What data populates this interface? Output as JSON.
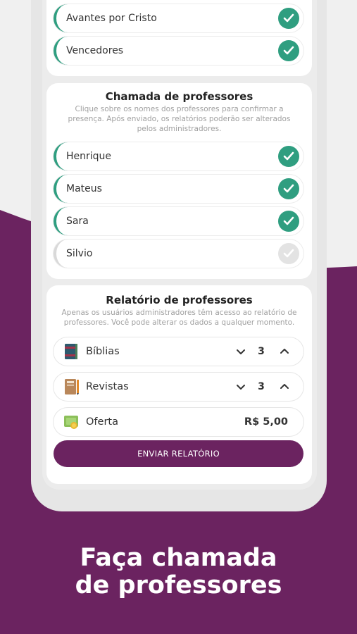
{
  "colors": {
    "accent": "#2f9e80",
    "brand": "#6b2360",
    "inactive": "#e3e3e3"
  },
  "classes": [
    {
      "name": "Avantes por Cristo",
      "checked": true
    },
    {
      "name": "Vencedores",
      "checked": true
    }
  ],
  "teachers_call": {
    "title": "Chamada de professores",
    "description": "Clique sobre os nomes dos professores para confirmar a presença. Após enviado, os relatórios poderão ser alterados pelos administradores.",
    "teachers": [
      {
        "name": "Henrique",
        "checked": true
      },
      {
        "name": "Mateus",
        "checked": true
      },
      {
        "name": "Sara",
        "checked": true
      },
      {
        "name": "Silvio",
        "checked": false
      }
    ]
  },
  "report": {
    "title": "Relatório de professores",
    "description": "Apenas os usuários administradores têm acesso ao relatório de professores. Você pode alterar os dados a qualquer momento.",
    "items": [
      {
        "label": "Bíblias",
        "value": "3",
        "icon": "bible-icon"
      },
      {
        "label": "Revistas",
        "value": "3",
        "icon": "magazine-icon"
      }
    ],
    "offering": {
      "label": "Oferta",
      "value": "R$ 5,00",
      "icon": "money-icon"
    },
    "submit_label": "ENVIAR RELATÓRIO"
  },
  "caption": {
    "line1": "Faça chamada",
    "line2": "de professores"
  }
}
